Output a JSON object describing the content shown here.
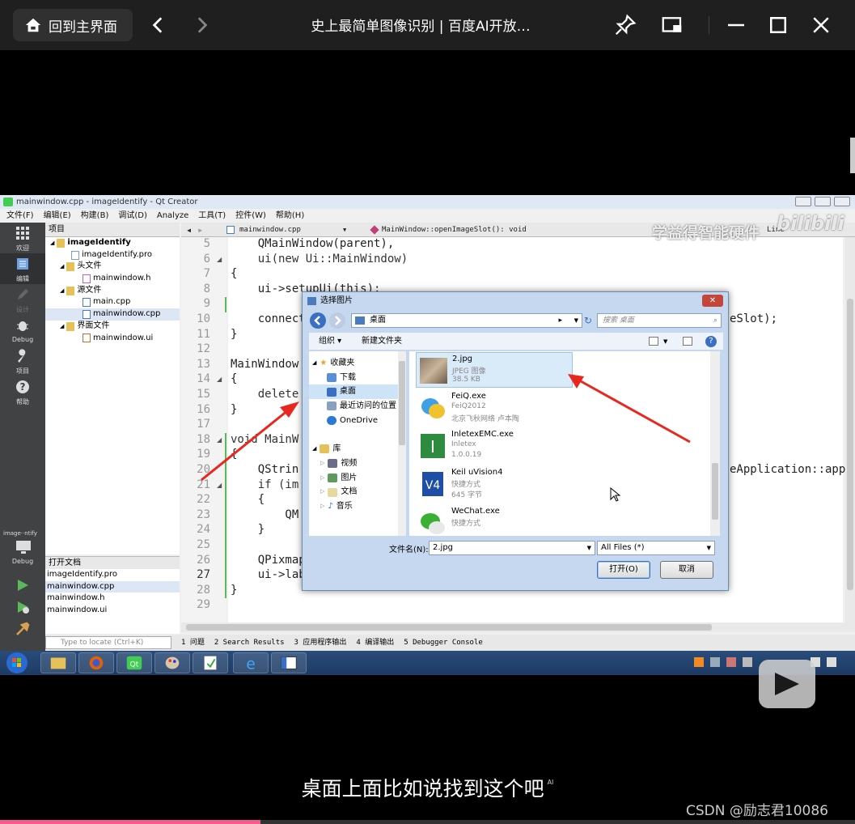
{
  "player": {
    "home_label": "回到主界面",
    "title": "史上最简单图像识别 | 百度AI开放…",
    "progress_fraction": 0.305
  },
  "qt": {
    "window_title": "mainwindow.cpp - imageIdentify - Qt Creator",
    "menu": [
      "文件(F)",
      "编辑(E)",
      "构建(B)",
      "调试(D)",
      "Analyze",
      "工具(T)",
      "控件(W)",
      "帮助(H)"
    ],
    "sidebar": [
      "欢迎",
      "编辑",
      "设计",
      "Debug",
      "项目",
      "帮助"
    ],
    "kit_label": "image··ntify",
    "kit_mode": "Debug",
    "project_header": "项目",
    "tree": [
      {
        "label": "imageIdentify",
        "level": 0,
        "bold": true
      },
      {
        "label": "imageIdentify.pro",
        "level": 1
      },
      {
        "label": "头文件",
        "level": 1
      },
      {
        "label": "mainwindow.h",
        "level": 2
      },
      {
        "label": "源文件",
        "level": 1
      },
      {
        "label": "main.cpp",
        "level": 2
      },
      {
        "label": "mainwindow.cpp",
        "level": 2,
        "selected": true
      },
      {
        "label": "界面文件",
        "level": 1
      },
      {
        "label": "mainwindow.ui",
        "level": 2
      }
    ],
    "open_docs_header": "打开文档",
    "open_docs": [
      "imageIdentify.pro",
      "mainwindow.cpp",
      "mainwindow.h",
      "mainwindow.ui"
    ],
    "editor_tab": "mainwindow.cpp",
    "editor_symbol": "MainWindow::openImageSlot(): void",
    "editor_right": "Line",
    "line_numbers": [
      "5",
      "6",
      "7",
      "8",
      "9",
      "10",
      "11",
      "12",
      "13",
      "14",
      "15",
      "16",
      "17",
      "18",
      "19",
      "20",
      "21",
      "22",
      "23",
      "24",
      "25",
      "26",
      "27",
      "28",
      "29"
    ],
    "code": [
      "    QMainWindow(parent),",
      "    ui(new Ui::MainWindow)",
      "{",
      "    ui->setupUi(this);",
      "",
      "    connect",
      "}",
      "",
      "MainWindow",
      "{",
      "    delete",
      "}",
      "",
      "void MainW",
      "{",
      "    QStrin",
      "    if (im",
      "    {",
      "        QM",
      "    }",
      "",
      "    QPixmap",
      "    ui->lab",
      "}",
      ""
    ],
    "code_right_10": "eSlot);",
    "code_right_20": "eApplication::app",
    "locate_placeholder": "Type to locate (Ctrl+K)",
    "status_tabs": [
      "1 问题",
      "2 Search Results",
      "3 应用程序输出",
      "4 编译输出",
      "5 Debugger Console"
    ]
  },
  "watermark": {
    "text": "学益得智能硬件",
    "brand": "bilibili"
  },
  "dialog": {
    "title": "选择图片",
    "address": "桌面",
    "search_placeholder": "搜索 桌面",
    "organize": "组织 ▾",
    "new_folder": "新建文件夹",
    "nav": [
      {
        "label": "收藏夹",
        "group": true
      },
      {
        "label": "下载"
      },
      {
        "label": "桌面",
        "selected": true
      },
      {
        "label": "最近访问的位置"
      },
      {
        "label": "OneDrive"
      },
      {
        "label": ""
      },
      {
        "label": "库",
        "group": true
      },
      {
        "label": "视频"
      },
      {
        "label": "图片"
      },
      {
        "label": "文档"
      },
      {
        "label": "音乐"
      }
    ],
    "files": [
      {
        "name": "2.jpg",
        "line1": "JPEG 图像",
        "line2": "38.5 KB",
        "selected": true
      },
      {
        "name": "FeiQ.exe",
        "line1": "FeiQ2012",
        "line2": "北京飞秋网络 卢本陶"
      },
      {
        "name": "InletexEMC.exe",
        "line1": "Inletex",
        "line2": "1.0.0.19"
      },
      {
        "name": "Keil uVision4",
        "line1": "快捷方式",
        "line2": "645 字节"
      },
      {
        "name": "WeChat.exe",
        "line1": "快捷方式",
        "line2": ""
      }
    ],
    "filename_label": "文件名(N):",
    "filename_value": "2.jpg",
    "filter_value": "All Files  (*)",
    "open_label": "打开(O)",
    "cancel_label": "取消"
  },
  "subtitle": "桌面上面比如说找到这个吧",
  "subtitle_tag": "AI",
  "csdn": "CSDN @励志君10086",
  "colors": {
    "accent_progress": "#f25d8e",
    "arrow": "#e8281e"
  }
}
